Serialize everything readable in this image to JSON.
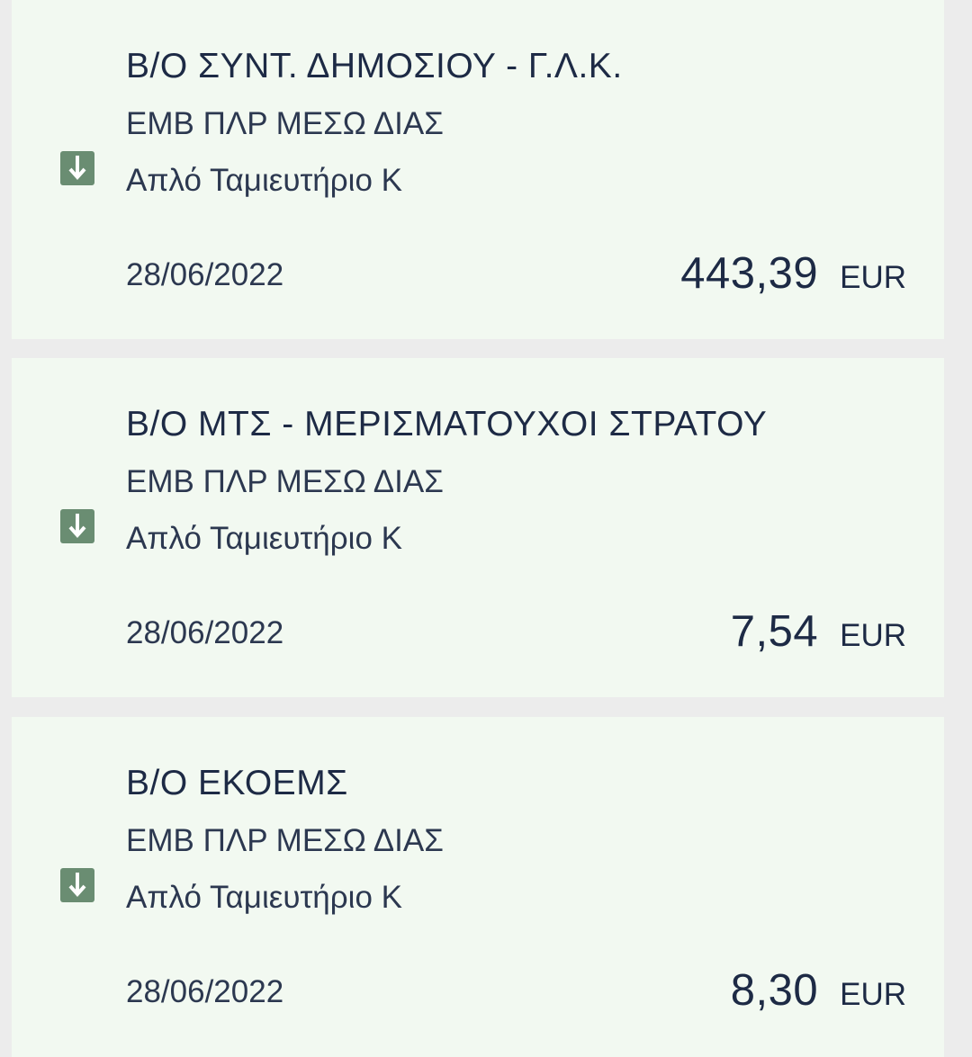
{
  "transactions": [
    {
      "title": "Β/Ο ΣΥΝΤ. ΔΗΜΟΣΙΟΥ - Γ.Λ.Κ.",
      "description": "ΕΜΒ ΠΛΡ ΜΕΣΩ ΔΙΑΣ",
      "account": "Απλό Ταμιευτήριο Κ",
      "date": "28/06/2022",
      "amount": "443,39",
      "currency": "EUR",
      "icon": "incoming-arrow-down-icon"
    },
    {
      "title": "Β/Ο ΜΤΣ - ΜΕΡΙΣΜΑΤΟΥΧΟΙ ΣΤΡΑΤΟΥ",
      "description": "ΕΜΒ ΠΛΡ ΜΕΣΩ ΔΙΑΣ",
      "account": "Απλό Ταμιευτήριο Κ",
      "date": "28/06/2022",
      "amount": "7,54",
      "currency": "EUR",
      "icon": "incoming-arrow-down-icon"
    },
    {
      "title": "Β/Ο ΕΚΟΕΜΣ",
      "description": "ΕΜΒ ΠΛΡ ΜΕΣΩ ΔΙΑΣ",
      "account": "Απλό Ταμιευτήριο Κ",
      "date": "28/06/2022",
      "amount": "8,30",
      "currency": "EUR",
      "icon": "incoming-arrow-down-icon"
    }
  ],
  "colors": {
    "background": "#ececec",
    "card": "#f2f9f1",
    "icon": "#6a8d72",
    "text": "#1d2a45"
  }
}
